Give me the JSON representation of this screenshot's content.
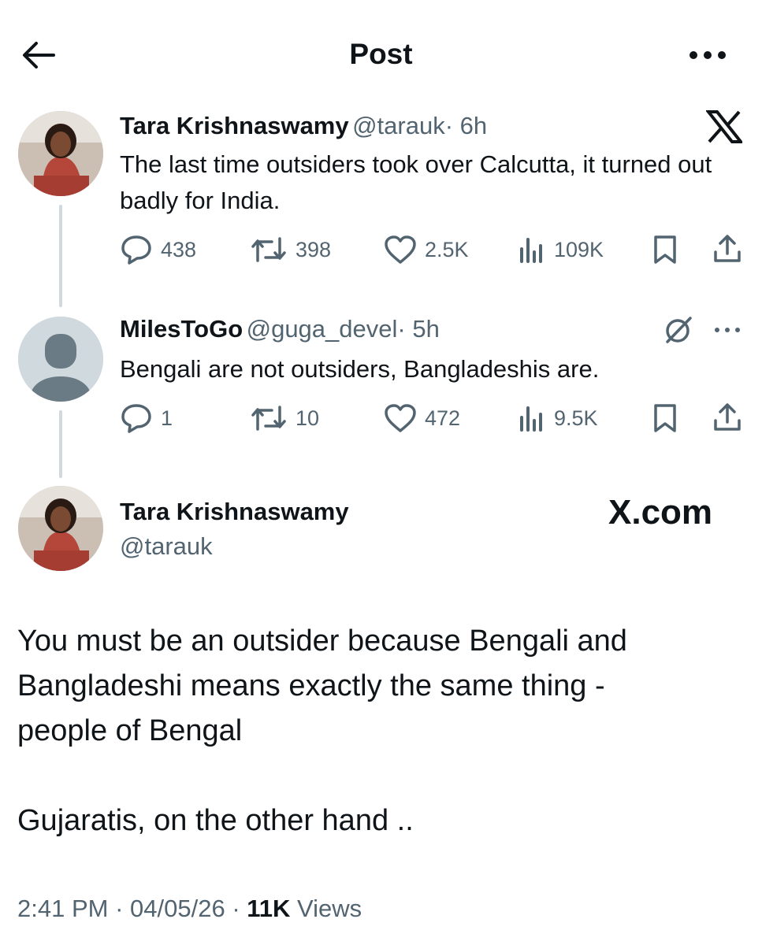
{
  "header": {
    "title": "Post",
    "back_icon": "arrow-left-icon",
    "more_icon": "more-horizontal-icon"
  },
  "tweet1": {
    "name": "Tara Krishnaswamy",
    "handle": "@tarauk",
    "time": "· 6h",
    "text": "The last time outsiders took over Calcutta, it turned out badly for India.",
    "replies": "438",
    "retweets": "398",
    "likes": "2.5K",
    "views": "109K"
  },
  "tweet2": {
    "name": "MilesToGo",
    "handle": "@guga_devel",
    "time": "· 5h",
    "text": "Bengali are not outsiders, Bangladeshis are.",
    "replies": "1",
    "retweets": "10",
    "likes": "472",
    "views": "9.5K"
  },
  "main": {
    "name": "Tara Krishnaswamy",
    "handle": "@tarauk",
    "brand": "X.com",
    "text": "You must be an outsider because Bengali and\nBangladeshi means exactly the same thing -\npeople  of Bengal\n\nGujaratis, on the other hand ..",
    "time": "2:41 PM",
    "date": "04/05/26",
    "views_count": "11K",
    "views_label": "Views"
  },
  "colors": {
    "text": "#0f1419",
    "secondary": "#536471",
    "thread": "#cfd9de"
  }
}
